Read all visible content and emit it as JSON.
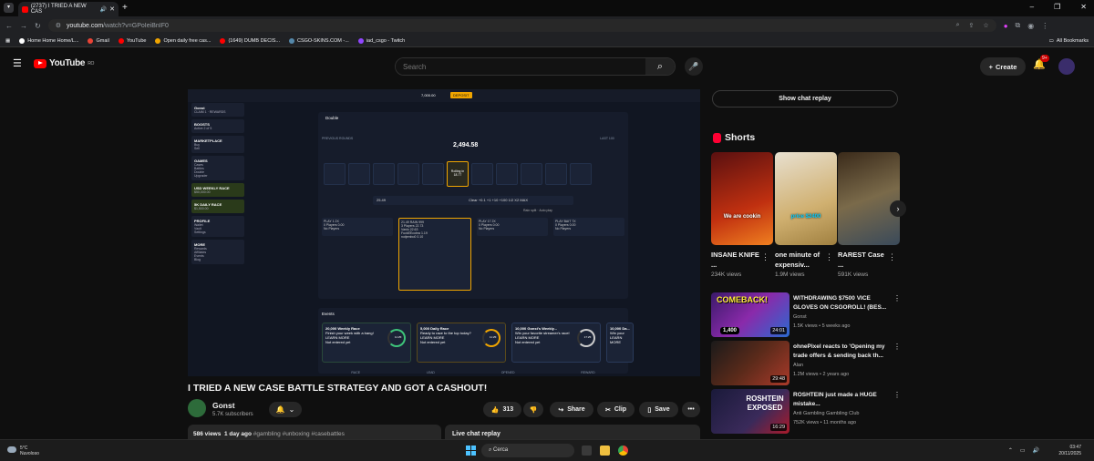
{
  "browser": {
    "tab_title": "(2737) I TRIED A NEW CAS",
    "url_host": "youtube.com",
    "url_path": "/watch?v=GPoIeiBnIF0",
    "bookmarks": [
      "Home Home Home/L...",
      "Gmail",
      "YouTube",
      "Open daily free cas...",
      "(1649) DUMB DECIS...",
      "CSGO-SKINS.COM -...",
      "iad_csgo - Twitch"
    ],
    "all_bookmarks": "All Bookmarks"
  },
  "header": {
    "logo": "YouTube",
    "region": "RO",
    "search_placeholder": "Search",
    "create": "Create",
    "notif_count": "9+"
  },
  "game": {
    "balance": "7,000.00",
    "deposit": "DEPOSIT",
    "user": "Gonst",
    "claim": "CLAIM 1",
    "rewards": "REWARDS",
    "boosts": "BOOSTS",
    "boosts_sub": "Active 2 of 5",
    "marketplace": "MARKETPLACE",
    "market_items": [
      "Buy",
      "Sell"
    ],
    "games": "GAMES",
    "game_items": [
      "Cases",
      "Battles",
      "Double",
      "Upgrader"
    ],
    "weekly": "USD WEEKLY RACE",
    "weekly_amt": "$50,000.00",
    "daily": "5K DAILY RACE",
    "daily_amt": "$1,500.00",
    "profile": "PROFILE",
    "profile_items": [
      "Wallet",
      "Vault",
      "Settings"
    ],
    "more": "MORE",
    "more_items": [
      "Rewards",
      "Affiliates",
      "Events",
      "Blog"
    ],
    "mode": "Double",
    "prev_rounds": "PREVIOUS ROUNDS",
    "last_100": "LAST 100",
    "pot": "2,494.58",
    "rolling": "Rolling in",
    "rolling_time": "18.77",
    "bet_value": "25.49",
    "bet_clear": "Clear",
    "bet_buttons": [
      "+0.1",
      "+1",
      "+10",
      "+100",
      "1/2",
      "X2",
      "MAX"
    ],
    "rain_split": "Rain split",
    "auto_play": "Auto play",
    "cols": [
      {
        "label": "PLAY 1",
        "mult": "2X",
        "players": "0 Players",
        "total": "0.00",
        "empty": "No Players"
      },
      {
        "label": "21.49",
        "mult": "RAIN 999",
        "players": "3 Players",
        "total": "22.73",
        "bets": [
          [
            "Vanlo",
            "22.63"
          ],
          [
            "FuckEEcobra",
            "1.19"
          ],
          [
            "notjembo0",
            "0.10"
          ]
        ]
      },
      {
        "label": "PLAY 17",
        "mult": "2X",
        "players": "0 Players",
        "total": "0.00",
        "empty": "No Players"
      },
      {
        "label": "PLAY BAIT",
        "mult": "7X",
        "players": "0 Players",
        "total": "0.00",
        "empty": "No Players"
      }
    ],
    "events_title": "Events",
    "events": [
      {
        "name": "20,000 Weekly Race",
        "desc": "Finish your week with a bang!",
        "timer": "11:25:",
        "btn": "LEARN MORE",
        "state": "Not entered yet"
      },
      {
        "name": "5,000 Daily Race",
        "desc": "Ready to race to the top today?",
        "timer": "11:25:",
        "btn": "LEARN MORE",
        "state": "Not entered yet"
      },
      {
        "name": "10,000 Gonst's Weekly...",
        "desc": "Win your favorite streamer's race!",
        "timer": "17:25:",
        "btn": "LEARN MORE",
        "state": "Not entered yet"
      },
      {
        "name": "10,000 Da...",
        "desc": "Win your",
        "timer": "",
        "btn": "LEARN MORE",
        "state": ""
      }
    ],
    "footer_cols": [
      "RACE",
      "LEAD",
      "OPENED",
      "REWARD"
    ]
  },
  "video": {
    "title": "I TRIED A NEW CASE BATTLE STRATEGY AND GOT A CASHOUT!",
    "channel": "Gonst",
    "subs": "5.7K subscribers",
    "likes": "313",
    "share": "Share",
    "clip": "Clip",
    "save": "Save",
    "views": "586 views",
    "age": "1 day ago",
    "tags": "#gambling #unboxing #casebattles",
    "live_chat": "Live chat replay"
  },
  "sidebar": {
    "chat_btn": "Show chat replay",
    "shorts_title": "Shorts",
    "shorts": [
      {
        "caption": "We are cookin",
        "title": "INSANE KNIFE ...",
        "views": "234K views"
      },
      {
        "caption": "price $2400",
        "title": "one minute of expensiv...",
        "views": "1.9M views"
      },
      {
        "caption": "",
        "title": "RAREST Case ...",
        "views": "591K views"
      }
    ],
    "recs": [
      {
        "thumb_text": "COMEBACK!",
        "price": "1,400",
        "dur": "24:01",
        "title": "WITHDRAWING $7500 VICE GLOVES ON CSGOROLL! (BES...",
        "channel": "Gonst",
        "meta": "1.5K views • 5 weeks ago"
      },
      {
        "thumb_text": "",
        "price": "",
        "dur": "29:48",
        "title": "ohnePixel reacts to 'Opening my trade offers & sending back th...",
        "channel": "Alan",
        "meta": "1.2M views • 2 years ago"
      },
      {
        "thumb_text": "ROSHTEIN EXPOSED",
        "price": "",
        "dur": "16:29",
        "title": "ROSHTEIN just made a HUGE mistake...",
        "channel": "Anti Gambling Gambling Club",
        "meta": "752K views • 11 months ago"
      }
    ]
  },
  "taskbar": {
    "temp": "5°C",
    "weather": "Nuvoloso",
    "search": "Cerca",
    "time": "03:47",
    "date": "20/11/2025"
  },
  "colors": {
    "accent": "#ff0000",
    "gold": "#f0a500",
    "bg": "#0f0f0f"
  }
}
